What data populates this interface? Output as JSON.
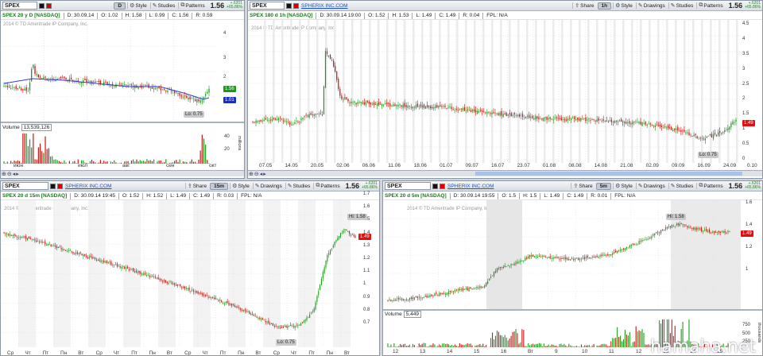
{
  "panels": {
    "p1": {
      "symbol": "SPEX",
      "tf": "D",
      "last": "1.56",
      "chg_top": "+.6201",
      "chg_bot": "+65.86%",
      "name": "SPEX 20 y D [NASDAQ]",
      "date": "D: 30.09.14",
      "o": "O: 1.02",
      "h": "H: 1.58",
      "l": "L: 0.99",
      "c": "C: 1.56",
      "v": "R: 0.59",
      "copyright": "2014 © TD Ameritrade IP Company, Inc.",
      "yticks": [
        "4",
        "3",
        "2"
      ],
      "price_tag": "1.56",
      "ma_tag": "1.01",
      "lo": "Lo: 0.75",
      "xticks": [
        "июн",
        "июл",
        "авг",
        "сен",
        "окт"
      ],
      "vol_label": "Volume",
      "vol_value": "13,539,126",
      "vol_ticks": [
        "40",
        "20"
      ],
      "vol_unit": "millions"
    },
    "p2": {
      "symbol": "SPEX",
      "tf": "1h",
      "last": "1.56",
      "chg_top": "+.6201",
      "chg_bot": "+65.86%",
      "company": "SPHERIX INC.COM",
      "name": "SPEX 180 d 1h [NASDAQ]",
      "date": "D: 30.09.14 19:00",
      "o": "O: 1.52",
      "h": "H: 1.53",
      "l": "L: 1.49",
      "c": "C: 1.49",
      "v": "R: 0.04",
      "fpl": "FPL: N/A",
      "copyright": "2014 © TD Ameritrade IP Company, Inc.",
      "yticks": [
        "4.5",
        "4",
        "3.5",
        "3",
        "2.5",
        "2",
        "1.5",
        "1",
        "0.5",
        "0"
      ],
      "price_tag": "1.49",
      "lo": "Lo: 0.75",
      "xticks": [
        "07.05",
        "14.05",
        "20.05",
        "02.06",
        "06.06",
        "11.06",
        "18.06",
        "01.07",
        "09.07",
        "16.07",
        "23.07",
        "01.08",
        "08.08",
        "14.08",
        "21.08",
        "02.09",
        "09.09",
        "16.09",
        "24.09"
      ],
      "x_end": "0.10"
    },
    "p3": {
      "symbol": "SPEX",
      "tf": "15m",
      "last": "1.56",
      "chg_top": "+.6201",
      "chg_bot": "+65.86%",
      "company": "SPHERIX INC.COM",
      "name": "SPEX 20 d 15m [NASDAQ]",
      "date": "D: 30.09.14 19:45",
      "o": "O: 1.52",
      "h": "H: 1.52",
      "l": "L: 1.49",
      "c": "C: 1.49",
      "v": "R: 0.03",
      "fpl": "FPL: N/A",
      "copyright": "2014 © TD Ameritrade IP Company, Inc.",
      "yticks": [
        "1.7",
        "1.6",
        "1.5",
        "1.4",
        "1.3",
        "1.2",
        "1.1",
        "1",
        "0.9",
        "0.8",
        "0.7"
      ],
      "price_tag": "1.49",
      "hi": "Hi: 1.58",
      "lo": "Lo: 0.75",
      "xticks": [
        "Ср",
        "Чт",
        "Пт",
        "Пн",
        "Вт",
        "Ср",
        "Чт",
        "Пт",
        "Пн",
        "Вт",
        "Ср",
        "Чт",
        "Пт",
        "Пн",
        "Вт",
        "Ср",
        "Чт",
        "Пт",
        "Пн",
        "Вт"
      ]
    },
    "p4": {
      "symbol": "SPEX",
      "tf": "5m",
      "last": "1.56",
      "chg_top": "+.6201",
      "chg_bot": "+65.86%",
      "company": "SPHERIX INC.COM",
      "name": "SPEX 20 d 5m [NASDAQ]",
      "date": "D: 30.09.14 19:55",
      "o": "O: 1.5",
      "h": "H: 1.5",
      "l": "L: 1.49",
      "c": "C: 1.49",
      "v": "R: 0.01",
      "fpl": "FPL: N/A",
      "copyright": "2014 © TD Ameritrade IP Company, Inc.",
      "yticks": [
        "1.6",
        "1.4",
        "1.2",
        "1"
      ],
      "price_tag": "1.49",
      "hi": "Hi: 1.58",
      "vol_label": "Volume",
      "vol_value": "5,449",
      "vol_ticks": [
        "750",
        "500",
        "250"
      ],
      "vol_unit": "thousands",
      "xticks": [
        "12",
        "13",
        "14",
        "15",
        "16",
        "Вт",
        "9",
        "10",
        "11",
        "12",
        "13",
        "14",
        "15"
      ]
    }
  },
  "toolbar": {
    "share": "Share",
    "style": "Style",
    "drawings": "Drawings",
    "studies": "Studies",
    "patterns": "Patterns"
  },
  "watermark": "hamaha.net",
  "colors": {
    "up": "#1a9a1a",
    "down": "#cc1111",
    "ma": "#2a3fd0",
    "bg": "#ffffff"
  }
}
